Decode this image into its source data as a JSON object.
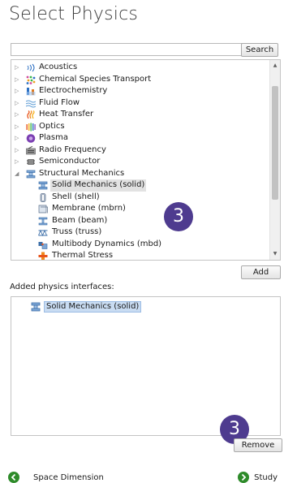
{
  "page": {
    "title": "Select Physics"
  },
  "search": {
    "value": "",
    "placeholder": "",
    "button_label": "Search"
  },
  "tree": {
    "items": [
      {
        "label": "Acoustics",
        "level": 0,
        "expanded": false,
        "icon": "acoustics-icon"
      },
      {
        "label": "Chemical Species Transport",
        "level": 0,
        "expanded": false,
        "icon": "chemical-species-icon"
      },
      {
        "label": "Electrochemistry",
        "level": 0,
        "expanded": false,
        "icon": "electrochemistry-icon"
      },
      {
        "label": "Fluid Flow",
        "level": 0,
        "expanded": false,
        "icon": "fluid-flow-icon"
      },
      {
        "label": "Heat Transfer",
        "level": 0,
        "expanded": false,
        "icon": "heat-transfer-icon"
      },
      {
        "label": "Optics",
        "level": 0,
        "expanded": false,
        "icon": "optics-icon"
      },
      {
        "label": "Plasma",
        "level": 0,
        "expanded": false,
        "icon": "plasma-icon"
      },
      {
        "label": "Radio Frequency",
        "level": 0,
        "expanded": false,
        "icon": "radio-frequency-icon"
      },
      {
        "label": "Semiconductor",
        "level": 0,
        "expanded": false,
        "icon": "semiconductor-icon"
      },
      {
        "label": "Structural Mechanics",
        "level": 0,
        "expanded": true,
        "icon": "structural-mechanics-icon"
      },
      {
        "label": "Solid Mechanics (solid)",
        "level": 1,
        "selected": true,
        "icon": "solid-mechanics-icon"
      },
      {
        "label": "Shell (shell)",
        "level": 1,
        "icon": "shell-icon"
      },
      {
        "label": "Membrane (mbrn)",
        "level": 1,
        "icon": "membrane-icon"
      },
      {
        "label": "Beam (beam)",
        "level": 1,
        "icon": "beam-icon"
      },
      {
        "label": "Truss (truss)",
        "level": 1,
        "icon": "truss-icon"
      },
      {
        "label": "Multibody Dynamics (mbd)",
        "level": 1,
        "icon": "multibody-dynamics-icon"
      },
      {
        "label": "Thermal Stress",
        "level": 1,
        "icon": "thermal-stress-icon"
      }
    ]
  },
  "buttons": {
    "add_label": "Add",
    "remove_label": "Remove"
  },
  "added": {
    "label": "Added physics interfaces:",
    "items": [
      {
        "label": "Solid Mechanics (solid)",
        "icon": "solid-mechanics-icon"
      }
    ]
  },
  "callouts": {
    "first": "3",
    "second": "3"
  },
  "nav": {
    "prev_label": "Space Dimension",
    "next_label": "Study"
  },
  "colors": {
    "callout": "#4e3b8f",
    "nav_green": "#2e8b2a",
    "selection": "#c9dcf2"
  }
}
